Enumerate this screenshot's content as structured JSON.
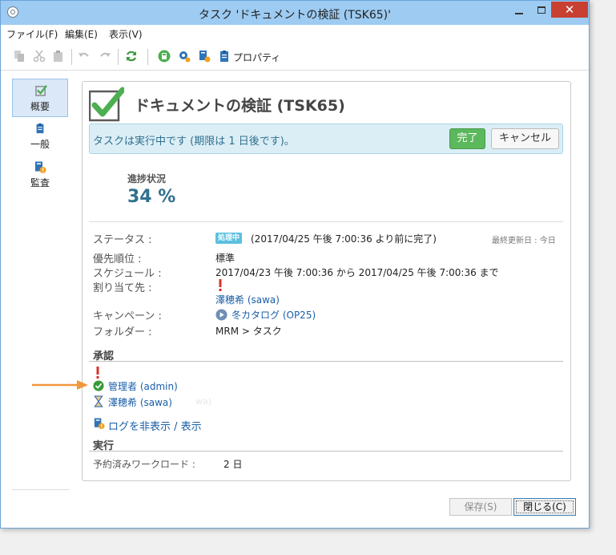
{
  "window": {
    "title": "タスク 'ドキュメントの検証 (TSK65)'",
    "close_glyph": "✕"
  },
  "menu": [
    "ファイル(F)",
    "編集(E)",
    "表示(V)"
  ],
  "toolbar": {
    "properties_label": "プロパティ"
  },
  "sidebar": {
    "items": [
      {
        "label": "概要",
        "icon": "checkbox-icon"
      },
      {
        "label": "一般",
        "icon": "clipboard-icon"
      },
      {
        "label": "監査",
        "icon": "audit-icon"
      }
    ]
  },
  "header": {
    "title": "ドキュメントの検証 (TSK65)"
  },
  "info": {
    "text": "タスクは実行中です (期限は 1 日後です)。",
    "done_label": "完了",
    "cancel_label": "キャンセル"
  },
  "progress": {
    "label": "進捗状況",
    "value": "34 %"
  },
  "details": {
    "status_label": "ステータス :",
    "status_badge": "処理中",
    "status_text": "(2017/04/25 午後 7:00:36 より前に完了)",
    "last_updated": "最終更新日 : 今日",
    "priority_label": "優先順位 :",
    "priority_value": "標準",
    "schedule_label": "スケジュール :",
    "schedule_value": "2017/04/23 午後 7:00:36 から 2017/04/25 午後 7:00:36 まで",
    "assignee_label": "割り当て先 :",
    "assignee_value": "澤穂希 (sawa)",
    "campaign_label": "キャンペーン :",
    "campaign_value": "冬カタログ (OP25)",
    "folder_label": "フォルダー :",
    "folder_value": "MRM > タスク"
  },
  "approval": {
    "section_label": "承認",
    "approvers": [
      "管理者 (admin)",
      "澤穂希 (sawa)"
    ],
    "faded_text": "wa)",
    "log_toggle": "ログを非表示 / 表示"
  },
  "execution": {
    "section_label": "実行",
    "workload_label": "予約済みワークロード :",
    "workload_value": "2 日"
  },
  "footer": {
    "save_label": "保存(S)",
    "close_label": "閉じる(C)"
  },
  "colors": {
    "accent": "#5cb85c",
    "info": "#31708f",
    "link": "#1a5fa8",
    "arrow": "#f0963c"
  }
}
